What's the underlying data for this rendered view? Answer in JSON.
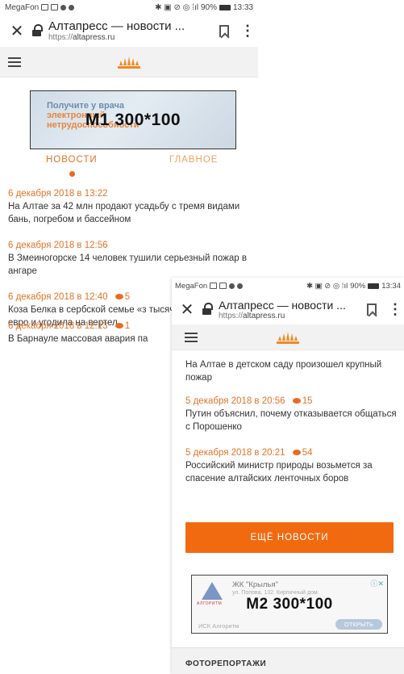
{
  "screen1": {
    "status": {
      "carrier": "MegaFon",
      "battery": "90%",
      "time": "13:33"
    },
    "browser": {
      "title": "Алтапресс — новости ...",
      "url_prefix": "https://",
      "url_domain": "altapress.ru"
    },
    "ad": {
      "label": "M1 300*100",
      "bg_lines": [
        "Получите у врача",
        "электронный",
        "нетрудоспособности"
      ]
    },
    "tabs": {
      "news": "НОВОСТИ",
      "main": "ГЛАВНОЕ"
    },
    "news": [
      {
        "date": "6 декабря 2018 в 13:22",
        "comments": "",
        "text": "На Алтае за 42 млн продают усадьбу с тремя видами бань, погребом и бассейном"
      },
      {
        "date": "6 декабря 2018 в 12:56",
        "comments": "",
        "text": "В Змеиногорске 14 человек тушили серьезный пожар в ангаре"
      },
      {
        "date": "6 декабря 2018 в 12:40",
        "comments": "5",
        "text": "Коза Белка в сербской семье «з тысяч евро и угодила на вертел"
      },
      {
        "date": "6 декабря 2018 в 12:13",
        "comments": "1",
        "text": "В Барнауле массовая авария па"
      }
    ]
  },
  "screen2": {
    "status": {
      "carrier": "MegaFon",
      "battery": "90%",
      "time": "13:34"
    },
    "browser": {
      "title": "Алтапресс — новости ...",
      "url_prefix": "https://",
      "url_domain": "altapress.ru"
    },
    "top_text": "На Алтае в детском саду произошел крупный пожар",
    "news": [
      {
        "date": "5 декабря 2018 в 20:56",
        "comments": "15",
        "text": "Путин объяснил, почему отказывается общаться с Порошенко"
      },
      {
        "date": "5 декабря 2018 в 20:21",
        "comments": "54",
        "text": "Российский министр природы возьмется за спасение алтайских ленточных боров"
      }
    ],
    "more_button": "ЕЩЁ НОВОСТИ",
    "ad": {
      "label": "M2 300*100",
      "title": "ЖК \"Крылья\"",
      "address": "ул. Попова, 132. Кирпичный дом.",
      "company": "ИСК Алгоритм",
      "logo_text": "АЛГОРИТМ",
      "button": "ОТКРЫТЬ"
    },
    "section_title": "ФОТОРЕПОРТАЖИ"
  },
  "colors": {
    "accent": "#f26a10",
    "date": "#e07428",
    "logo": "#f08a24"
  },
  "icons": [
    "close-icon",
    "lock-icon",
    "bookmark-icon",
    "more-vert-icon",
    "hamburger-icon",
    "sun-logo-icon",
    "comment-icon"
  ]
}
